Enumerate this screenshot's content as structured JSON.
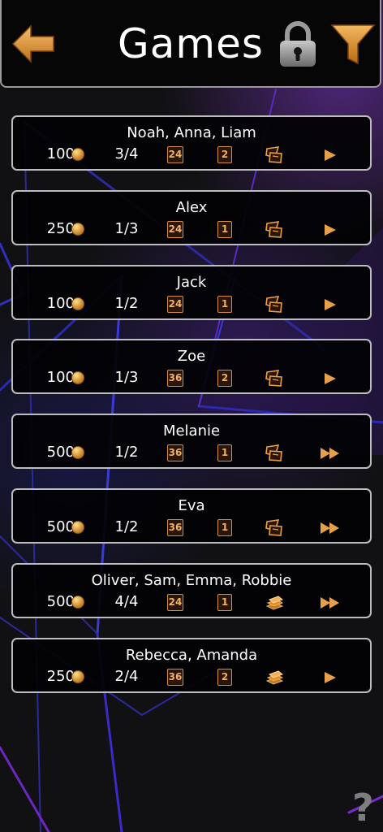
{
  "header": {
    "title": "Games",
    "icons": {
      "back": "back-arrow-icon",
      "lock": "padlock-icon",
      "filter": "funnel-filter-icon"
    }
  },
  "games": [
    {
      "names": "Noah, Anna, Liam",
      "stake": "100",
      "players": "3/4",
      "deck": "24",
      "rounds": "2",
      "mode": "cards-down",
      "speed": "normal"
    },
    {
      "names": "Alex",
      "stake": "250",
      "players": "1/3",
      "deck": "24",
      "rounds": "1",
      "mode": "cards-down",
      "speed": "normal"
    },
    {
      "names": "Jack",
      "stake": "100",
      "players": "1/2",
      "deck": "24",
      "rounds": "1",
      "mode": "cards-down",
      "speed": "normal"
    },
    {
      "names": "Zoe",
      "stake": "100",
      "players": "1/3",
      "deck": "36",
      "rounds": "2",
      "mode": "cards-down",
      "speed": "normal"
    },
    {
      "names": "Melanie",
      "stake": "500",
      "players": "1/2",
      "deck": "36",
      "rounds": "1",
      "mode": "cards-down",
      "speed": "fast"
    },
    {
      "names": "Eva",
      "stake": "500",
      "players": "1/2",
      "deck": "36",
      "rounds": "1",
      "mode": "cards-down",
      "speed": "fast"
    },
    {
      "names": "Oliver, Sam, Emma, Robbie",
      "stake": "500",
      "players": "4/4",
      "deck": "24",
      "rounds": "1",
      "mode": "cards-stack",
      "speed": "fast"
    },
    {
      "names": "Rebecca, Amanda",
      "stake": "250",
      "players": "2/4",
      "deck": "36",
      "rounds": "2",
      "mode": "cards-stack",
      "speed": "normal"
    }
  ],
  "help": {
    "label": "?"
  },
  "colors": {
    "accent": "#e09a3c",
    "row_border": "#bdbdbd",
    "background": "#111113",
    "purple_glow": "#5a2a8a"
  }
}
